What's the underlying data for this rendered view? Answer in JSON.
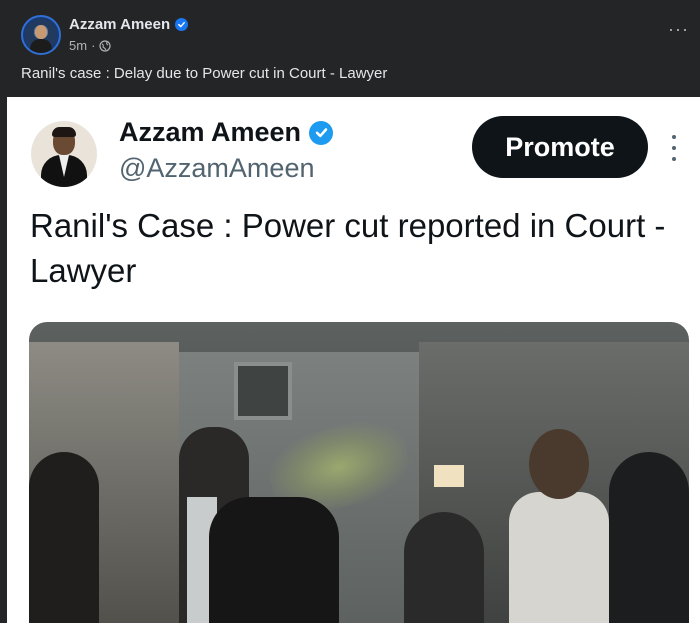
{
  "fb_post": {
    "author_name": "Azzam Ameen",
    "time": "5m",
    "separator": "·",
    "caption": "Ranil's case : Delay due to Power cut in Court - Lawyer",
    "more_label": "···"
  },
  "tweet": {
    "display_name": "Azzam Ameen",
    "handle": "@AzzamAmeen",
    "promote_label": "Promote",
    "text": "Ranil's Case : Power cut reported in Court - Lawyer"
  },
  "colors": {
    "fb_background": "#242526",
    "fb_verified": "#1877f2",
    "tw_verified": "#1d9bf0",
    "promote_button": "#0f1419"
  },
  "icons": {
    "fb_verified": "verified-badge-icon",
    "privacy": "globe-icon",
    "fb_more": "more-horizontal-icon",
    "tw_verified": "verified-badge-icon",
    "tw_more": "more-vertical-icon"
  }
}
